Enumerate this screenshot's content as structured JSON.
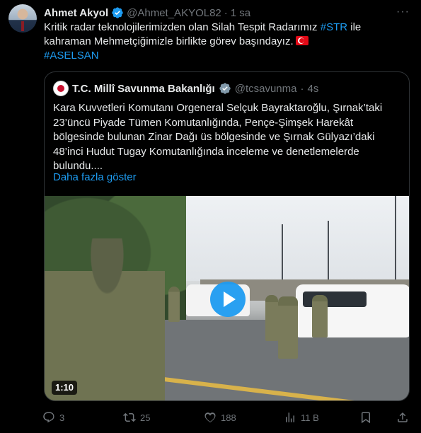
{
  "tweet": {
    "author_name": "Ahmet Akyol",
    "handle": "@Ahmet_AKYOL82",
    "separator": "·",
    "time": "1 sa",
    "text_lines": [
      "Kritik radar teknolojilerimizden olan Silah Tespit Radarımız",
      "kahraman Mehmetçiğimizle birlikte görev başındayız."
    ],
    "hashtag_str": "#STR",
    "text_after_str": " ile",
    "hashtag_aselsan": "#ASELSAN",
    "more_label": "···"
  },
  "quote": {
    "author_name": "T.C. Millî Savunma Bakanlığı",
    "handle": "@tcsavunma",
    "separator": "·",
    "time": "4s",
    "text_lines": [
      "Kara Kuvvetleri Komutanı Orgeneral Selçuk Bayraktaroğlu, Şırnak’taki",
      "23’üncü Piyade Tümen Komutanlığında, Pençe-Şimşek Harekât",
      "bölgesinde bulunan Zinar Dağı üs bölgesinde ve Şırnak Gülyazı’daki",
      "48’inci Hudut Tugay Komutanlığında inceleme ve denetlemelerde",
      "bulundu...."
    ],
    "show_more": "Daha fazla göster",
    "video_duration": "1:10"
  },
  "actions": {
    "replies": "3",
    "reposts": "25",
    "likes": "188",
    "views": "11 B"
  },
  "colors": {
    "background": "#000000",
    "text": "#e7e9ea",
    "muted": "#71767b",
    "accent": "#1d9bf0",
    "border": "#2f3336"
  },
  "icons": [
    "verified-badge-icon",
    "more-icon",
    "turkish-flag-icon",
    "gray-verified-badge-icon",
    "play-icon",
    "reply-icon",
    "repost-icon",
    "like-icon",
    "views-icon",
    "bookmark-icon",
    "share-icon"
  ]
}
